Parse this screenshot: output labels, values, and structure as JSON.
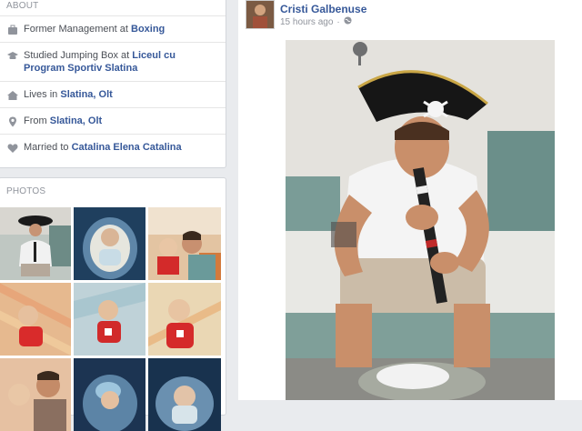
{
  "about": {
    "title": "ABOUT",
    "items": [
      {
        "icon": "briefcase-icon",
        "prefix": "Former Management at ",
        "link": "Boxing"
      },
      {
        "icon": "graduation-cap-icon",
        "prefix": "Studied Jumping Box at ",
        "link": "Liceul cu Program Sportiv Slatina"
      },
      {
        "icon": "house-icon",
        "prefix": "Lives in ",
        "link": "Slatina, Olt"
      },
      {
        "icon": "location-pin-icon",
        "prefix": "From ",
        "link": "Slatina, Olt"
      },
      {
        "icon": "heart-icon",
        "prefix": "Married to ",
        "link": "Catalina Elena Catalina"
      }
    ]
  },
  "photos": {
    "title": "PHOTOS",
    "thumbnails": [
      {
        "label": "man-pirate-hat-photo"
      },
      {
        "label": "baby-in-bassinet-photo"
      },
      {
        "label": "man-kissing-baby-photo"
      },
      {
        "label": "baby-on-blanket-photo"
      },
      {
        "label": "baby-red-shirt-photo"
      },
      {
        "label": "baby-red-shirt-close-photo"
      },
      {
        "label": "baby-with-man-photo"
      },
      {
        "label": "baby-blue-hat-photo"
      },
      {
        "label": "baby-sleeping-photo"
      }
    ]
  },
  "post": {
    "author": "Cristi Galbenuse",
    "time": "15 hours ago",
    "privacy_icon": "globe-icon"
  }
}
